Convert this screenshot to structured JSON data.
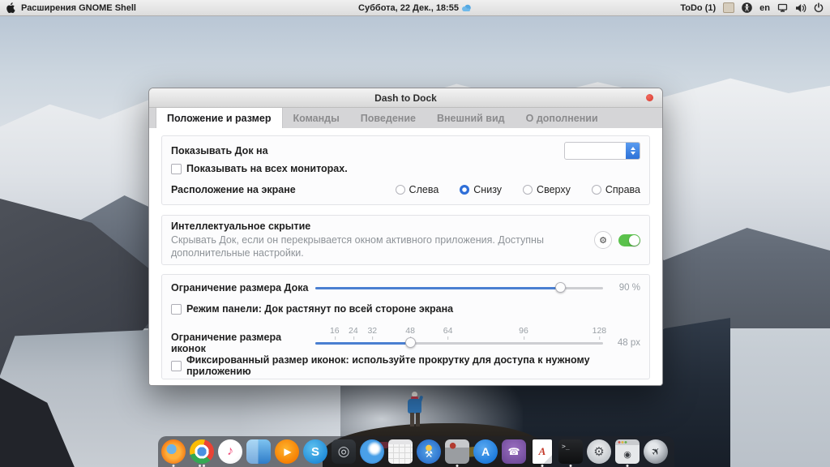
{
  "topbar": {
    "app_menu": "Расширения GNOME Shell",
    "clock": "Суббота, 22 Дек., 18:55",
    "todo_badge": "ToDo (1)",
    "keyboard_layout": "en"
  },
  "dialog": {
    "title": "Dash to Dock",
    "tabs": [
      {
        "label": "Положение и размер",
        "active": true
      },
      {
        "label": "Команды",
        "active": false
      },
      {
        "label": "Поведение",
        "active": false
      },
      {
        "label": "Внешний вид",
        "active": false
      },
      {
        "label": "О дополнении",
        "active": false
      }
    ],
    "position_section": {
      "show_dock_label": "Показывать Док на",
      "dropdown_value": "",
      "all_monitors_label": "Показывать на всех мониторах.",
      "all_monitors_checked": false,
      "screen_position_label": "Расположение на экране",
      "position_options": [
        "Слева",
        "Снизу",
        "Сверху",
        "Справа"
      ],
      "selected_option": "Снизу"
    },
    "smart_hide_section": {
      "title": "Интеллектуальное скрытие",
      "description": "Скрывать Док, если он перекрывается окном активного приложения. Доступны дополнительные настройки.",
      "enabled": true
    },
    "size_section": {
      "dock_size_label": "Ограничение размера Дока",
      "dock_size_value": "90 %",
      "dock_size_percent": 90,
      "panel_mode_label": "Режим панели: Док растянут по всей стороне экрана",
      "panel_mode_checked": false,
      "icon_size_label": "Ограничение размера иконок",
      "icon_size_value": "48 px",
      "icon_size_ticks": [
        16,
        24,
        32,
        48,
        64,
        96,
        128
      ],
      "icon_size_current": 48,
      "fixed_icon_label": "Фиксированный размер иконок: используйте прокрутку для доступа к нужному приложению",
      "fixed_icon_checked": false
    }
  },
  "dock": {
    "items": [
      {
        "id": "firefox",
        "glyph": "",
        "dots": 1
      },
      {
        "id": "chrome",
        "glyph": "",
        "dots": 2
      },
      {
        "id": "music",
        "glyph": "♪",
        "dots": 0
      },
      {
        "id": "finder",
        "glyph": "",
        "dots": 0
      },
      {
        "id": "media-player",
        "glyph": "▶",
        "dots": 0
      },
      {
        "id": "skype",
        "glyph": "S",
        "dots": 0
      },
      {
        "id": "steering-wheel",
        "glyph": "◎",
        "dots": 0
      },
      {
        "id": "browser-eagle",
        "glyph": "",
        "dots": 0
      },
      {
        "id": "calendar",
        "glyph": "",
        "dots": 0
      },
      {
        "id": "tools",
        "glyph": "⚒",
        "dots": 0
      },
      {
        "id": "package",
        "glyph": "",
        "dots": 1
      },
      {
        "id": "app-store",
        "glyph": "A",
        "dots": 0
      },
      {
        "id": "viber",
        "glyph": "☎",
        "dots": 0
      },
      {
        "id": "text-document",
        "glyph": "A",
        "dots": 1
      },
      {
        "id": "terminal",
        "glyph": ">_",
        "dots": 1
      },
      {
        "id": "settings",
        "glyph": "⚙",
        "dots": 0
      },
      {
        "id": "screenshot",
        "glyph": "◉",
        "dots": 1
      },
      {
        "id": "launchpad",
        "glyph": "✈",
        "dots": 0
      }
    ]
  },
  "colors": {
    "accent_blue": "#2f6fd8",
    "toggle_green": "#5bc24c",
    "close_red": "#d9382c"
  }
}
